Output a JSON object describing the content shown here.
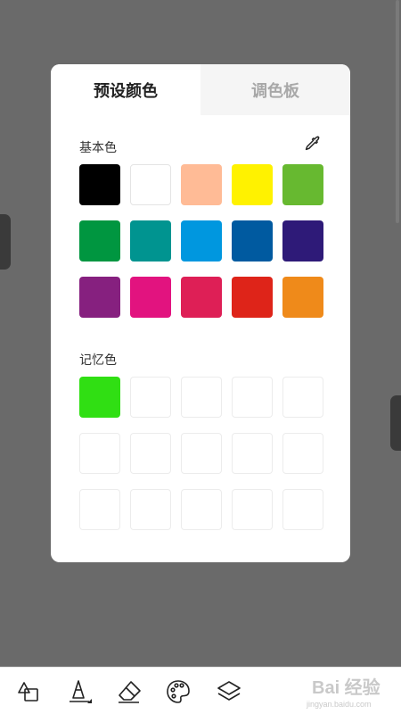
{
  "tabs": [
    {
      "label": "预设颜色",
      "active": true
    },
    {
      "label": "调色板",
      "active": false
    }
  ],
  "basic": {
    "label": "基本色",
    "colors": [
      "#000000",
      "#ffffff",
      "#ffbb96",
      "#fff200",
      "#67b930",
      "#009640",
      "#009490",
      "#0097df",
      "#005aa0",
      "#2e1a78",
      "#86207f",
      "#e2137f",
      "#de1f56",
      "#de2419",
      "#ef8a1a"
    ]
  },
  "memory": {
    "label": "记忆色",
    "colors": [
      "#30df13",
      "",
      "",
      "",
      "",
      "",
      "",
      "",
      "",
      "",
      "",
      "",
      "",
      "",
      ""
    ]
  },
  "icons": {
    "eyedropper": "eyedropper-icon",
    "toolbar": [
      "shapes-icon",
      "pen-icon",
      "eraser-icon",
      "palette-icon",
      "layers-icon"
    ]
  },
  "watermark": {
    "main": "Bai 经验",
    "sub": "jingyan.baidu.com"
  }
}
